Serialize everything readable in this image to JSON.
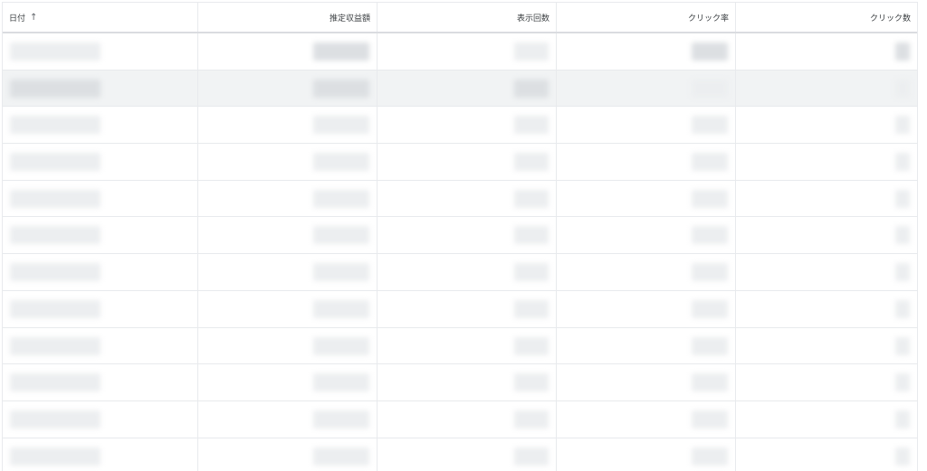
{
  "table": {
    "columns": [
      {
        "label": "日付",
        "sort_icon": "arrow-up-icon",
        "sort_glyph": "↑"
      },
      {
        "label": "推定収益額"
      },
      {
        "label": "表示回数"
      },
      {
        "label": "クリック率"
      },
      {
        "label": "クリック数"
      }
    ],
    "highlighted_row": 2,
    "row_count": 12
  }
}
